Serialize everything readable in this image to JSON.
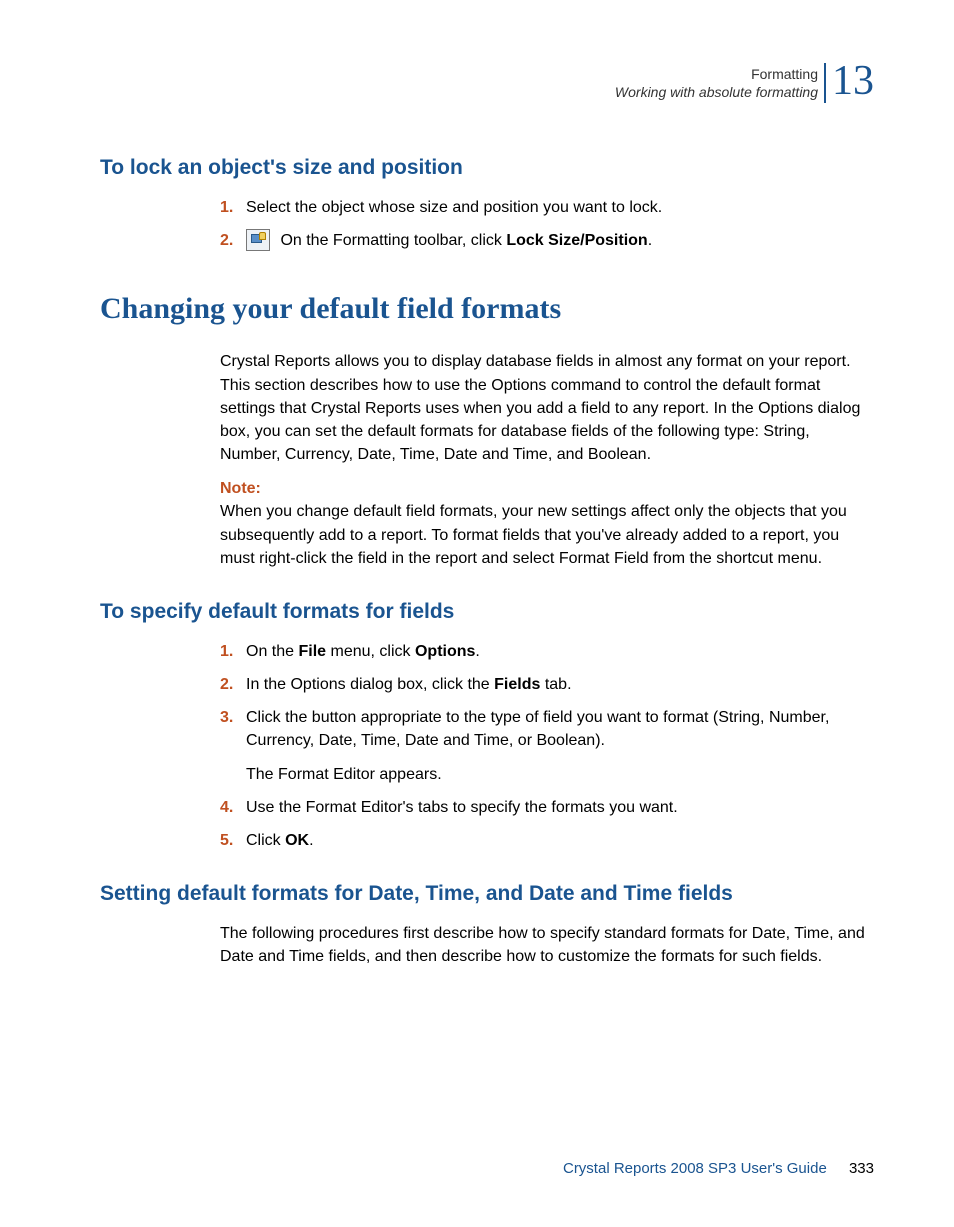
{
  "header": {
    "title": "Formatting",
    "subtitle": "Working with absolute formatting",
    "chapter": "13"
  },
  "section1": {
    "heading": "To lock an object's size and position",
    "steps": {
      "n1": "1.",
      "s1": "Select the object whose size and position you want to lock.",
      "n2": "2.",
      "s2_prefix": " On the Formatting toolbar, click ",
      "s2_bold": "Lock Size/Position",
      "s2_suffix": "."
    }
  },
  "section2": {
    "heading": "Changing your default field formats",
    "para": "Crystal Reports allows you to display database fields in almost any format on your report. This section describes how to use the Options command to control the default format settings that Crystal Reports uses when you add a field to any report. In the Options dialog box, you can set the default formats for database fields of the following type: String, Number, Currency, Date, Time, Date and Time, and Boolean.",
    "note_label": "Note:",
    "note_text": "When you change default field formats, your new settings affect only the objects that you subsequently add to a report. To format fields that you've already added to a report, you must right-click the field in the report and select Format Field from the shortcut menu."
  },
  "section3": {
    "heading": "To specify default formats for fields",
    "steps": {
      "n1": "1.",
      "s1_a": "On the ",
      "s1_b": "File",
      "s1_c": " menu, click ",
      "s1_d": "Options",
      "s1_e": ".",
      "n2": "2.",
      "s2_a": "In the Options dialog box, click the ",
      "s2_b": "Fields",
      "s2_c": " tab.",
      "n3": "3.",
      "s3": "Click the button appropriate to the type of field you want to format (String, Number, Currency, Date, Time, Date and Time, or Boolean).",
      "s3_follow": "The Format Editor appears.",
      "n4": "4.",
      "s4": "Use the Format Editor's tabs to specify the formats you want.",
      "n5": "5.",
      "s5_a": "Click ",
      "s5_b": "OK",
      "s5_c": "."
    }
  },
  "section4": {
    "heading": "Setting default formats for Date, Time, and Date and Time fields",
    "para": "The following procedures first describe how to specify standard formats for Date, Time, and Date and Time fields, and then describe how to customize the formats for such fields."
  },
  "footer": {
    "guide": "Crystal Reports 2008 SP3 User's Guide",
    "page": "333"
  }
}
